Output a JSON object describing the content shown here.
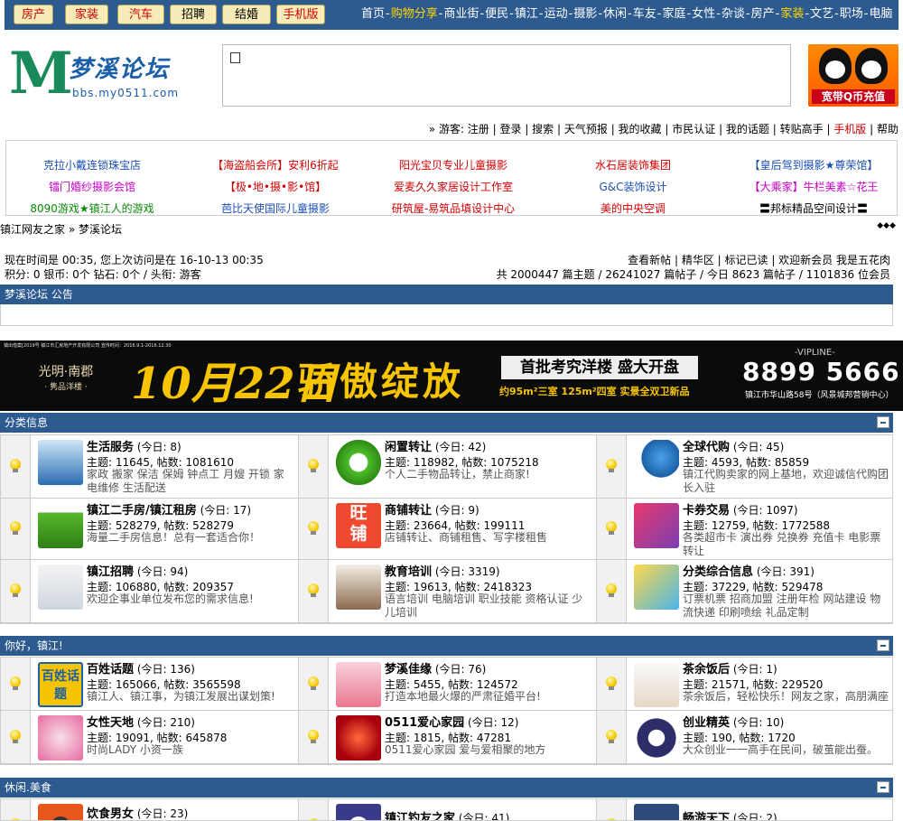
{
  "topbar": {
    "buttons": [
      {
        "label": "房产",
        "color": "red"
      },
      {
        "label": "家装",
        "color": "red"
      },
      {
        "label": "汽车",
        "color": "red"
      },
      {
        "label": "招聘",
        "color": "black"
      },
      {
        "label": "结婚",
        "color": "black"
      },
      {
        "label": "手机版",
        "color": "red"
      }
    ],
    "nav": [
      {
        "label": "首页",
        "hl": false
      },
      {
        "label": "购物分享",
        "hl": true
      },
      {
        "label": "商业街",
        "hl": false
      },
      {
        "label": "便民",
        "hl": false
      },
      {
        "label": "镇江",
        "hl": false
      },
      {
        "label": "运动",
        "hl": false
      },
      {
        "label": "摄影",
        "hl": false
      },
      {
        "label": "休闲",
        "hl": false
      },
      {
        "label": "车友",
        "hl": false
      },
      {
        "label": "家庭",
        "hl": false
      },
      {
        "label": "女性",
        "hl": false
      },
      {
        "label": "杂谈",
        "hl": false
      },
      {
        "label": "房产",
        "hl": false
      },
      {
        "label": "家装",
        "hl": true
      },
      {
        "label": "文艺",
        "hl": false
      },
      {
        "label": "职场",
        "hl": false
      },
      {
        "label": "电脑",
        "hl": false
      }
    ]
  },
  "header": {
    "logo_letter": "M",
    "logo_title": "梦溪论坛",
    "logo_url": "bbs.my0511.com",
    "qq_ad": "宽带Q币充值"
  },
  "userlinks": {
    "prefix": "» 游客:",
    "items": [
      "注册",
      "登录",
      "搜索",
      "天气预报",
      "我的收藏",
      "市民认证",
      "我的话题",
      "转贴高手",
      "手机版",
      "帮助"
    ]
  },
  "ad_links": [
    {
      "text": "克拉小戴连锁珠宝店",
      "color": "#1b4fb0"
    },
    {
      "text": "【海盗船会所】安利6折起",
      "color": "#d40000"
    },
    {
      "text": "阳光宝贝专业儿童摄影",
      "color": "#d40000"
    },
    {
      "text": "水石居装饰集团",
      "color": "#d40000"
    },
    {
      "text": "【皇后驾到摄影★尊荣馆】",
      "color": "#1b4fb0"
    },
    {
      "text": "镭门婚纱摄影会馆",
      "color": "#c800c8"
    },
    {
      "text": "【极•地•摄•影•馆】",
      "color": "#d40000"
    },
    {
      "text": "爱麦久久家居设计工作室",
      "color": "#d40000"
    },
    {
      "text": "G&C装饰设计",
      "color": "#1b4fb0"
    },
    {
      "text": "【大乘家】牛栏美素☆花王",
      "color": "#c800c8"
    },
    {
      "text": "8090游戏★镇江人的游戏",
      "color": "#0a8a0a"
    },
    {
      "text": "芭比天使国际儿童摄影",
      "color": "#1b4fb0"
    },
    {
      "text": "研筑屋-易筑品填设计中心",
      "color": "#d40000"
    },
    {
      "text": "美的中央空调",
      "color": "#d40000"
    },
    {
      "text": "〓邦标精品空间设计〓",
      "color": "#000000"
    }
  ],
  "breadcrumb": "镇江网友之家 » 梦溪论坛",
  "arrows": "◆◆◆",
  "status": {
    "time_line": "现在时间是  00:35, 您上次访问是在  16-10-13 00:35",
    "credits_line": "积分: 0  银币: 0个  钻石: 0个  / 头衔: 游客",
    "quick_links": "查看新帖 | 精华区 | 标记已读 | 欢迎新会员  我是五花肉",
    "totals": "共  2000447 篇主题  / 26241027 篇帖子  / 今日  8623 篇帖子  / 1101836 位会员"
  },
  "announce_title": "梦溪论坛  公告",
  "banner": {
    "fine_print": "镇出借案[2019号 镇江市汇房地产开发有限公司 宣传时间：2016.9.1-2016.12.30",
    "brand": "光明·南郡",
    "brand_sub": "· 隽品洋楼 ·",
    "date": "10月22日",
    "slogan": "骄傲绽放",
    "open": "首批考究洋楼 盛大开盘",
    "units": "约95m²三室 125m²四室 实景全双卫新品",
    "vip": "-VIPLINE-",
    "tel": "8899 5666",
    "addr": "镇江市华山路58号（风景城邦营销中心）"
  },
  "sections": [
    {
      "title": "分类信息",
      "forums": [
        {
          "name": "生活服务",
          "today": "(今日: 8)",
          "topics": "11645",
          "posts": "1081610",
          "desc": "家政 搬家 保洁 保姆 钟点工 月嫂 开锁 家电维修 生活配送",
          "icon": "workers-icon"
        },
        {
          "name": "闲置转让",
          "today": "(今日: 42)",
          "topics": "118982",
          "posts": "1075218",
          "desc": "个人二手物品转让，禁止商家!",
          "icon": "recycle-icon"
        },
        {
          "name": "全球代购",
          "today": "(今日: 45)",
          "topics": "4593",
          "posts": "85859",
          "desc": "镇江代购卖家的网上基地，欢迎诚信代购团长入驻",
          "icon": "shopping-cart-icon"
        },
        {
          "name": "镇江二手房/镇江租房",
          "today": "(今日: 17)",
          "topics": "528279",
          "posts": "528279",
          "desc": "海量二手房信息！总有一套适合你！",
          "icon": "grass-house-icon"
        },
        {
          "name": "商铺转让",
          "today": "(今日: 9)",
          "topics": "23664",
          "posts": "199111",
          "desc": "店铺转让、商铺租售、写字楼租售",
          "icon": "shop-sign-icon"
        },
        {
          "name": "卡券交易",
          "today": "(今日: 1097)",
          "topics": "12759",
          "posts": "1772588",
          "desc": "各类超市卡 演出券 兑换券 充值卡 电影票转让",
          "icon": "coupon-icon"
        },
        {
          "name": "镇江招聘",
          "today": "(今日: 94)",
          "topics": "106880",
          "posts": "209357",
          "desc": "欢迎企事业单位发布您的需求信息!",
          "icon": "handshake-icon"
        },
        {
          "name": "教育培训",
          "today": "(今日: 3319)",
          "topics": "19613",
          "posts": "2418323",
          "desc": "语言培训 电脑培训 职业技能 资格认证 少儿培训",
          "icon": "teacher-icon"
        },
        {
          "name": "分类综合信息",
          "today": "(今日: 391)",
          "topics": "37229",
          "posts": "529478",
          "desc": "订票机票 招商加盟 注册年检 网站建设 物流快递 印刷喷绘 礼品定制",
          "icon": "info-box-icon"
        }
      ]
    },
    {
      "title": "你好，镇江!",
      "forums": [
        {
          "name": "百姓话题",
          "today": "(今日: 136)",
          "topics": "165066",
          "posts": "3565598",
          "desc": "镇江人、镇江事，为镇江发展出谋划策!",
          "icon": "talk-icon",
          "logo": "百姓话题"
        },
        {
          "name": "梦溪佳缘",
          "today": "(今日: 76)",
          "topics": "5455",
          "posts": "124572",
          "desc": "打造本地最火爆的严肃征婚平台!",
          "icon": "couple-icon"
        },
        {
          "name": "茶余饭后",
          "today": "(今日: 1)",
          "topics": "21571",
          "posts": "229520",
          "desc": "茶余饭后，轻松快乐！网友之家，高朋满座",
          "icon": "teacup-icon"
        },
        {
          "name": "女性天地",
          "today": "(今日: 210)",
          "topics": "19091",
          "posts": "645878",
          "desc": "时尚LADY 小资一族",
          "icon": "woman-icon"
        },
        {
          "name": "0511爱心家园",
          "today": "(今日: 12)",
          "topics": "1815",
          "posts": "47281",
          "desc": "0511爱心家园  爱与爱相聚的地方",
          "icon": "heart-icon"
        },
        {
          "name": "创业精英",
          "today": "(今日: 10)",
          "topics": "190",
          "posts": "1720",
          "desc": "大众创业一一高手在民间，破茧能出蚕。",
          "icon": "emblem-icon"
        }
      ]
    },
    {
      "title": "休闲.美食",
      "forums": [
        {
          "name": "饮食男女",
          "today": "(今日: 23)",
          "icon": "food-icon"
        },
        {
          "name": "镇江钓友之家",
          "today": "(今日: 41)",
          "icon": "fishing-icon"
        },
        {
          "name": "畅游天下",
          "today": "(今日: 2)",
          "icon": "travel-icon"
        }
      ]
    }
  ],
  "labels": {
    "topics": "主题: ",
    "posts": ", 帖数: "
  }
}
